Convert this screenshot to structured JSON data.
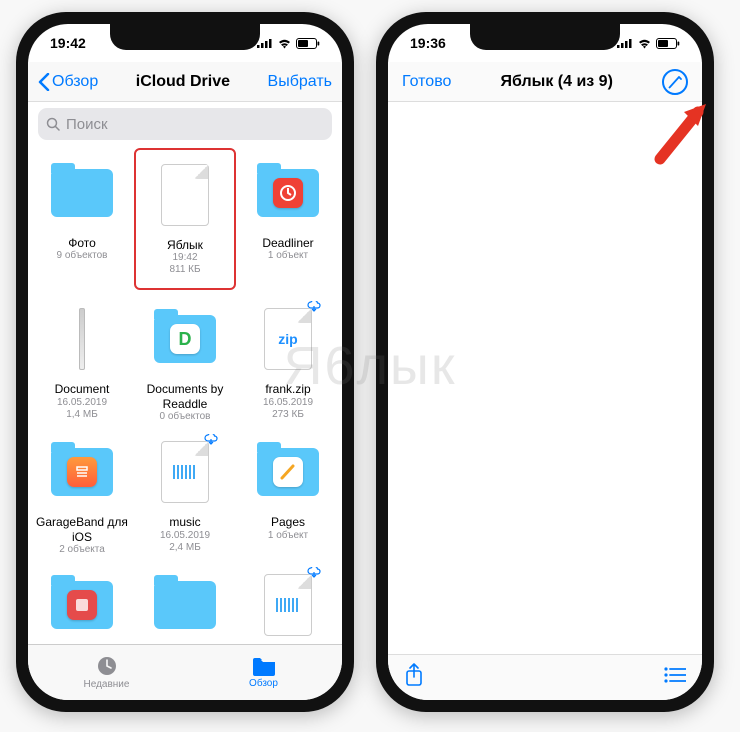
{
  "watermark": "Я6лык",
  "phone1": {
    "time": "19:42",
    "nav_back": "Обзор",
    "nav_title": "iCloud Drive",
    "nav_select": "Выбрать",
    "search_placeholder": "Поиск",
    "items": [
      {
        "name": "Фото",
        "meta": "9 объектов",
        "kind": "folder"
      },
      {
        "name": "Яблык",
        "meta": "19:42",
        "meta2": "811 КБ",
        "kind": "doc-blank",
        "highlight": true
      },
      {
        "name": "Deadliner",
        "meta": "1 объект",
        "kind": "folder-app-deadliner"
      },
      {
        "name": "Document",
        "meta": "16.05.2019",
        "meta2": "1,4 МБ",
        "kind": "doc-thin"
      },
      {
        "name": "Documents by Readdle",
        "meta": "0 объектов",
        "kind": "folder-app-documents"
      },
      {
        "name": "frank.zip",
        "meta": "16.05.2019",
        "meta2": "273 КБ",
        "kind": "doc-zip",
        "cloud": true
      },
      {
        "name": "GarageBand для iOS",
        "meta": "2 объекта",
        "kind": "folder-app-garageband"
      },
      {
        "name": "music",
        "meta": "16.05.2019",
        "meta2": "2,4 МБ",
        "kind": "doc-audio",
        "cloud": true
      },
      {
        "name": "Pages",
        "meta": "1 объект",
        "kind": "folder-app-pages"
      },
      {
        "name": "",
        "meta": "",
        "kind": "folder-app-red"
      },
      {
        "name": "",
        "meta": "",
        "kind": "folder"
      },
      {
        "name": "",
        "meta": "",
        "kind": "doc-audio",
        "cloud": true
      }
    ],
    "tab_recents": "Недавние",
    "tab_browse": "Обзор"
  },
  "phone2": {
    "time": "19:36",
    "done": "Готово",
    "title": "Яблык (4 из 9)"
  },
  "colors": {
    "ios_blue": "#007aff"
  }
}
